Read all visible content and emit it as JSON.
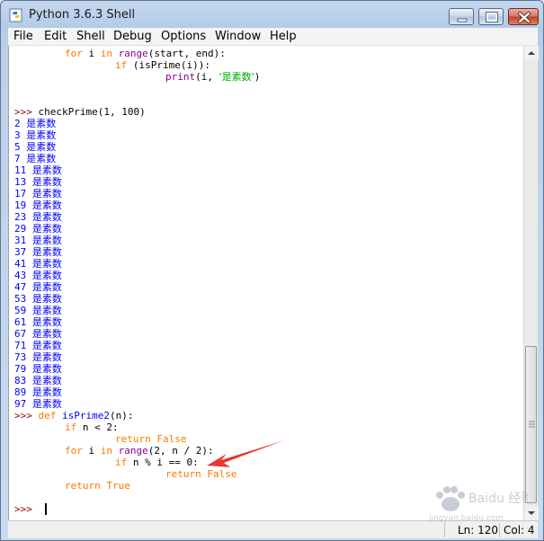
{
  "window": {
    "title": "Python 3.6.3 Shell"
  },
  "menu": {
    "items": [
      "File",
      "Edit",
      "Shell",
      "Debug",
      "Options",
      "Window",
      "Help"
    ]
  },
  "code": {
    "def_tail": [
      {
        "kw": "for",
        "sp1": " i ",
        "kw2": "in",
        "sp2": " ",
        "bi": "range",
        "rest": "(start, end):"
      },
      {
        "kw": "if",
        "rest": " (isPrime(i)):"
      },
      {
        "bi": "print",
        "rest1": "(i, ",
        "str": "'是素数'",
        "rest2": ")"
      }
    ],
    "prompt": ">>> ",
    "call": "checkPrime(1, 100)",
    "output_label": "是素数",
    "primes": [
      "2",
      "3",
      "5",
      "7",
      "11",
      "13",
      "17",
      "19",
      "23",
      "29",
      "31",
      "37",
      "41",
      "43",
      "47",
      "53",
      "59",
      "61",
      "67",
      "71",
      "73",
      "79",
      "83",
      "89",
      "97"
    ],
    "new_def": {
      "kw_def": "def",
      "name": "isPrime2",
      "params": "(n):",
      "l1_kw": "if",
      "l1_rest": " n < 2:",
      "l2_kw1": "return",
      "l2_kw2": "False",
      "l3_kw": "for",
      "l3_mid": " i ",
      "l3_in": "in",
      "l3_bi": "range",
      "l3_rest": "(2, n / 2):",
      "l4_kw": "if",
      "l4_rest": " n % i == 0:",
      "l5_kw1": "return",
      "l5_kw2": "False",
      "l6_kw1": "return",
      "l6_kw2": "True"
    },
    "final_prompt": ">>>"
  },
  "status": {
    "line": "Ln: 120",
    "col": "Col: 4"
  },
  "colors": {
    "keyword": "#ff7700",
    "builtin": "#900090",
    "string": "#00aa00",
    "defname": "#0000ff",
    "prompt": "#8b0000",
    "output": "#0000ff",
    "annotation": "#e8382f"
  },
  "icons": {
    "app": "python-idle-icon",
    "minimize": "minimize-icon",
    "maximize": "maximize-icon",
    "close": "close-icon"
  },
  "watermark": {
    "text": "Baidu 经验",
    "subtext": "jingyan.baidu.com"
  }
}
